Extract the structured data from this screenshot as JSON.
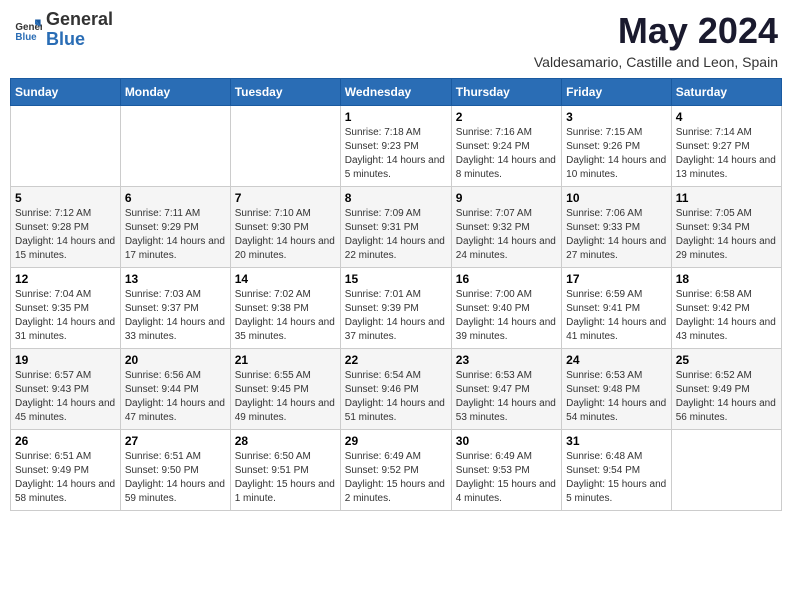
{
  "logo": {
    "general": "General",
    "blue": "Blue"
  },
  "title": "May 2024",
  "subtitle": "Valdesamario, Castille and Leon, Spain",
  "days_of_week": [
    "Sunday",
    "Monday",
    "Tuesday",
    "Wednesday",
    "Thursday",
    "Friday",
    "Saturday"
  ],
  "weeks": [
    [
      {
        "day": "",
        "sunrise": "",
        "sunset": "",
        "daylight": ""
      },
      {
        "day": "",
        "sunrise": "",
        "sunset": "",
        "daylight": ""
      },
      {
        "day": "",
        "sunrise": "",
        "sunset": "",
        "daylight": ""
      },
      {
        "day": "1",
        "sunrise": "Sunrise: 7:18 AM",
        "sunset": "Sunset: 9:23 PM",
        "daylight": "Daylight: 14 hours and 5 minutes."
      },
      {
        "day": "2",
        "sunrise": "Sunrise: 7:16 AM",
        "sunset": "Sunset: 9:24 PM",
        "daylight": "Daylight: 14 hours and 8 minutes."
      },
      {
        "day": "3",
        "sunrise": "Sunrise: 7:15 AM",
        "sunset": "Sunset: 9:26 PM",
        "daylight": "Daylight: 14 hours and 10 minutes."
      },
      {
        "day": "4",
        "sunrise": "Sunrise: 7:14 AM",
        "sunset": "Sunset: 9:27 PM",
        "daylight": "Daylight: 14 hours and 13 minutes."
      }
    ],
    [
      {
        "day": "5",
        "sunrise": "Sunrise: 7:12 AM",
        "sunset": "Sunset: 9:28 PM",
        "daylight": "Daylight: 14 hours and 15 minutes."
      },
      {
        "day": "6",
        "sunrise": "Sunrise: 7:11 AM",
        "sunset": "Sunset: 9:29 PM",
        "daylight": "Daylight: 14 hours and 17 minutes."
      },
      {
        "day": "7",
        "sunrise": "Sunrise: 7:10 AM",
        "sunset": "Sunset: 9:30 PM",
        "daylight": "Daylight: 14 hours and 20 minutes."
      },
      {
        "day": "8",
        "sunrise": "Sunrise: 7:09 AM",
        "sunset": "Sunset: 9:31 PM",
        "daylight": "Daylight: 14 hours and 22 minutes."
      },
      {
        "day": "9",
        "sunrise": "Sunrise: 7:07 AM",
        "sunset": "Sunset: 9:32 PM",
        "daylight": "Daylight: 14 hours and 24 minutes."
      },
      {
        "day": "10",
        "sunrise": "Sunrise: 7:06 AM",
        "sunset": "Sunset: 9:33 PM",
        "daylight": "Daylight: 14 hours and 27 minutes."
      },
      {
        "day": "11",
        "sunrise": "Sunrise: 7:05 AM",
        "sunset": "Sunset: 9:34 PM",
        "daylight": "Daylight: 14 hours and 29 minutes."
      }
    ],
    [
      {
        "day": "12",
        "sunrise": "Sunrise: 7:04 AM",
        "sunset": "Sunset: 9:35 PM",
        "daylight": "Daylight: 14 hours and 31 minutes."
      },
      {
        "day": "13",
        "sunrise": "Sunrise: 7:03 AM",
        "sunset": "Sunset: 9:37 PM",
        "daylight": "Daylight: 14 hours and 33 minutes."
      },
      {
        "day": "14",
        "sunrise": "Sunrise: 7:02 AM",
        "sunset": "Sunset: 9:38 PM",
        "daylight": "Daylight: 14 hours and 35 minutes."
      },
      {
        "day": "15",
        "sunrise": "Sunrise: 7:01 AM",
        "sunset": "Sunset: 9:39 PM",
        "daylight": "Daylight: 14 hours and 37 minutes."
      },
      {
        "day": "16",
        "sunrise": "Sunrise: 7:00 AM",
        "sunset": "Sunset: 9:40 PM",
        "daylight": "Daylight: 14 hours and 39 minutes."
      },
      {
        "day": "17",
        "sunrise": "Sunrise: 6:59 AM",
        "sunset": "Sunset: 9:41 PM",
        "daylight": "Daylight: 14 hours and 41 minutes."
      },
      {
        "day": "18",
        "sunrise": "Sunrise: 6:58 AM",
        "sunset": "Sunset: 9:42 PM",
        "daylight": "Daylight: 14 hours and 43 minutes."
      }
    ],
    [
      {
        "day": "19",
        "sunrise": "Sunrise: 6:57 AM",
        "sunset": "Sunset: 9:43 PM",
        "daylight": "Daylight: 14 hours and 45 minutes."
      },
      {
        "day": "20",
        "sunrise": "Sunrise: 6:56 AM",
        "sunset": "Sunset: 9:44 PM",
        "daylight": "Daylight: 14 hours and 47 minutes."
      },
      {
        "day": "21",
        "sunrise": "Sunrise: 6:55 AM",
        "sunset": "Sunset: 9:45 PM",
        "daylight": "Daylight: 14 hours and 49 minutes."
      },
      {
        "day": "22",
        "sunrise": "Sunrise: 6:54 AM",
        "sunset": "Sunset: 9:46 PM",
        "daylight": "Daylight: 14 hours and 51 minutes."
      },
      {
        "day": "23",
        "sunrise": "Sunrise: 6:53 AM",
        "sunset": "Sunset: 9:47 PM",
        "daylight": "Daylight: 14 hours and 53 minutes."
      },
      {
        "day": "24",
        "sunrise": "Sunrise: 6:53 AM",
        "sunset": "Sunset: 9:48 PM",
        "daylight": "Daylight: 14 hours and 54 minutes."
      },
      {
        "day": "25",
        "sunrise": "Sunrise: 6:52 AM",
        "sunset": "Sunset: 9:49 PM",
        "daylight": "Daylight: 14 hours and 56 minutes."
      }
    ],
    [
      {
        "day": "26",
        "sunrise": "Sunrise: 6:51 AM",
        "sunset": "Sunset: 9:49 PM",
        "daylight": "Daylight: 14 hours and 58 minutes."
      },
      {
        "day": "27",
        "sunrise": "Sunrise: 6:51 AM",
        "sunset": "Sunset: 9:50 PM",
        "daylight": "Daylight: 14 hours and 59 minutes."
      },
      {
        "day": "28",
        "sunrise": "Sunrise: 6:50 AM",
        "sunset": "Sunset: 9:51 PM",
        "daylight": "Daylight: 15 hours and 1 minute."
      },
      {
        "day": "29",
        "sunrise": "Sunrise: 6:49 AM",
        "sunset": "Sunset: 9:52 PM",
        "daylight": "Daylight: 15 hours and 2 minutes."
      },
      {
        "day": "30",
        "sunrise": "Sunrise: 6:49 AM",
        "sunset": "Sunset: 9:53 PM",
        "daylight": "Daylight: 15 hours and 4 minutes."
      },
      {
        "day": "31",
        "sunrise": "Sunrise: 6:48 AM",
        "sunset": "Sunset: 9:54 PM",
        "daylight": "Daylight: 15 hours and 5 minutes."
      },
      {
        "day": "",
        "sunrise": "",
        "sunset": "",
        "daylight": ""
      }
    ]
  ]
}
